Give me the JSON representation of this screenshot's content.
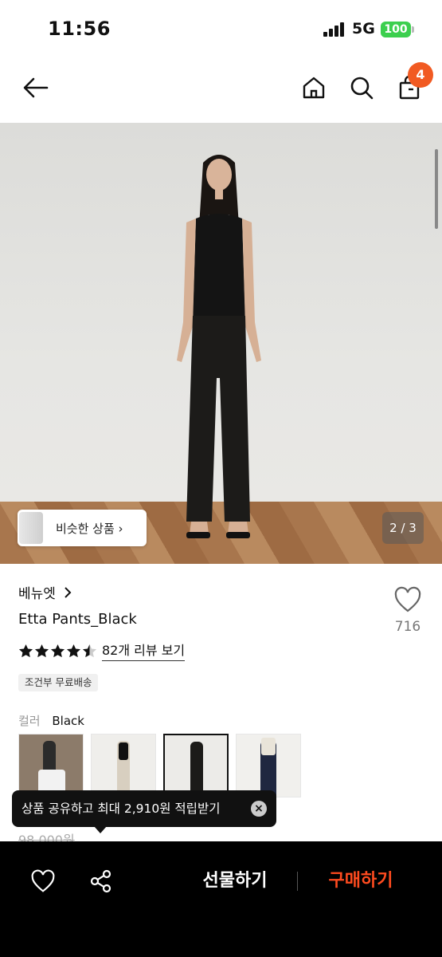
{
  "status": {
    "time": "11:56",
    "network": "5G",
    "battery": "100"
  },
  "header": {
    "cart_count": "4"
  },
  "hero": {
    "similar_label": "비슷한 상품",
    "pager": "2 / 3"
  },
  "product": {
    "brand": "베뉴엣",
    "title": "Etta Pants_Black",
    "wish_count": "716",
    "rating": 4.5,
    "review_link": "82개 리뷰 보기",
    "shipping_badge": "조건부 무료배송",
    "color_label": "컬러",
    "color_value": "Black",
    "swatches": [
      "color-option-1",
      "color-option-2",
      "color-option-3",
      "color-option-4"
    ],
    "original_price": "98,000원"
  },
  "tooltip": {
    "text": "상품 공유하고 최대 2,910원 적립받기"
  },
  "bottom": {
    "gift_label": "선물하기",
    "buy_label": "구매하기"
  },
  "colors": {
    "accent": "#f15a22",
    "buy": "#ff4b1f",
    "battery": "#3ccf4e"
  }
}
